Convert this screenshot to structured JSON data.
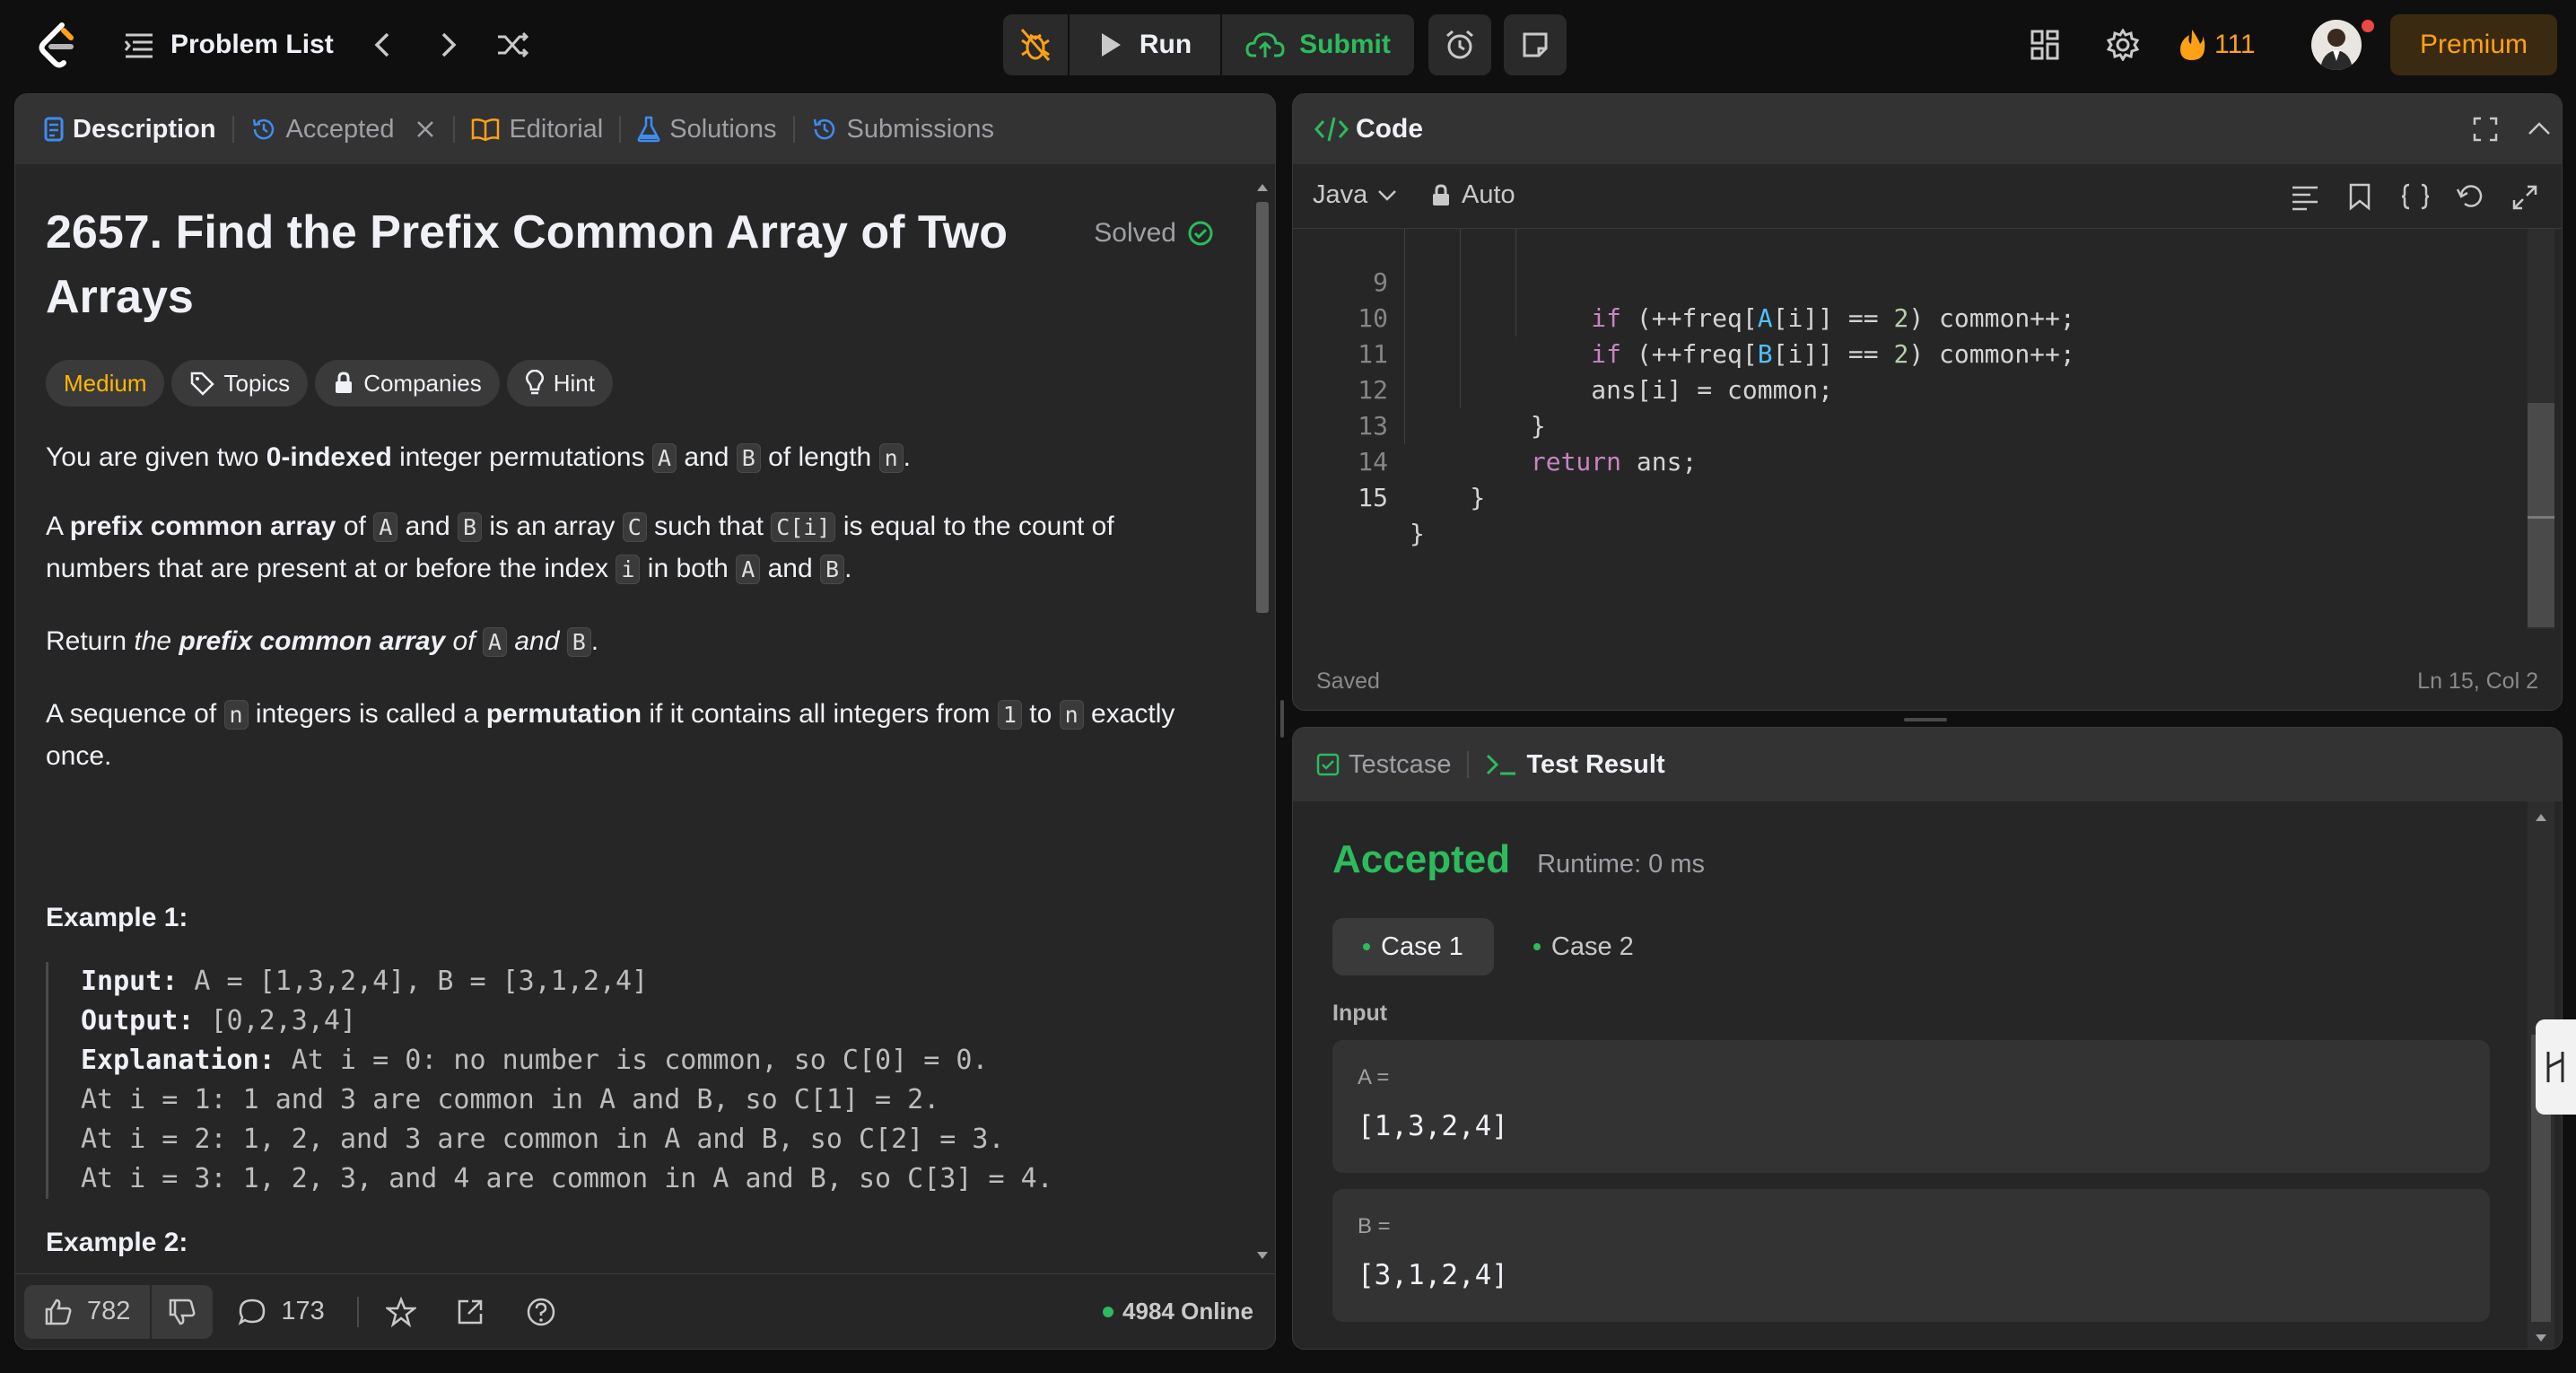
{
  "topbar": {
    "problem_list": "Problem List",
    "run": "Run",
    "submit": "Submit",
    "streak": "111",
    "premium": "Premium"
  },
  "description": {
    "tabs": [
      "Description",
      "Accepted",
      "Editorial",
      "Solutions",
      "Submissions"
    ],
    "title": "2657. Find the Prefix Common Array of Two Arrays",
    "solved": "Solved",
    "difficulty": "Medium",
    "pills": [
      "Topics",
      "Companies",
      "Hint"
    ],
    "p1": {
      "a": "You are given two ",
      "b": "0-indexed",
      "c": " integer permutations ",
      "A": "A",
      "and": " and ",
      "B": "B",
      "d": " of length ",
      "n": "n",
      "e": "."
    },
    "p2": {
      "a": "A ",
      "b": "prefix common array",
      "c": " of ",
      "A": "A",
      "and": " and ",
      "B": "B",
      "d": " is an array ",
      "C": "C",
      "e": " such that ",
      "Ci": "C[i]",
      "f": " is equal to the count of numbers that are present at or before the index ",
      "i": "i",
      "g": " in both ",
      "h": "."
    },
    "p3": {
      "a": "Return ",
      "b": "the ",
      "c": "prefix common array",
      "d": " of ",
      "A": "A",
      "e": " and ",
      "B": "B",
      "f": "."
    },
    "p4": {
      "a": "A sequence of ",
      "n": "n",
      "b": " integers is called a ",
      "c": "permutation",
      "d": " if it contains all integers from ",
      "one": "1",
      "e": " to ",
      "f": " exactly once."
    },
    "example1_title": "Example 1:",
    "example1": {
      "input_label": "Input:",
      "input": " A = [1,3,2,4], B = [3,1,2,4]",
      "output_label": "Output:",
      "output": " [0,2,3,4]",
      "expl_label": "Explanation:",
      "expl": [
        " At i = 0: no number is common, so C[0] = 0.",
        "At i = 1: 1 and 3 are common in A and B, so C[1] = 2.",
        "At i = 2: 1, 2, and 3 are common in A and B, so C[2] = 3.",
        "At i = 3: 1, 2, 3, and 4 are common in A and B, so C[3] = 4."
      ]
    },
    "example2_title": "Example 2:",
    "footer": {
      "likes": "782",
      "comments": "173",
      "online": "4984 Online"
    }
  },
  "code": {
    "title": "Code",
    "language": "Java",
    "mode": "Auto",
    "status": "Saved",
    "cursor": "Ln 15, Col 2",
    "line_numbers": [
      "9",
      "10",
      "11",
      "12",
      "13",
      "14",
      "15"
    ],
    "lines": [
      "            if (++freq[A[i]] == 2) common++;",
      "            if (++freq[B[i]] == 2) common++;",
      "            ans[i] = common;",
      "        }",
      "        return ans;",
      "    }",
      "}"
    ]
  },
  "result": {
    "tabs": [
      "Testcase",
      "Test Result"
    ],
    "status": "Accepted",
    "runtime": "Runtime: 0 ms",
    "cases": [
      "Case 1",
      "Case 2"
    ],
    "input_label": "Input",
    "params": [
      {
        "name": "A =",
        "value": "[1,3,2,4]"
      },
      {
        "name": "B =",
        "value": "[3,1,2,4]"
      }
    ]
  },
  "colors": {
    "accent_green": "#2cbb5d",
    "medium": "#ffb800",
    "streak": "#ffa116",
    "link_blue": "#3e8cf1"
  }
}
